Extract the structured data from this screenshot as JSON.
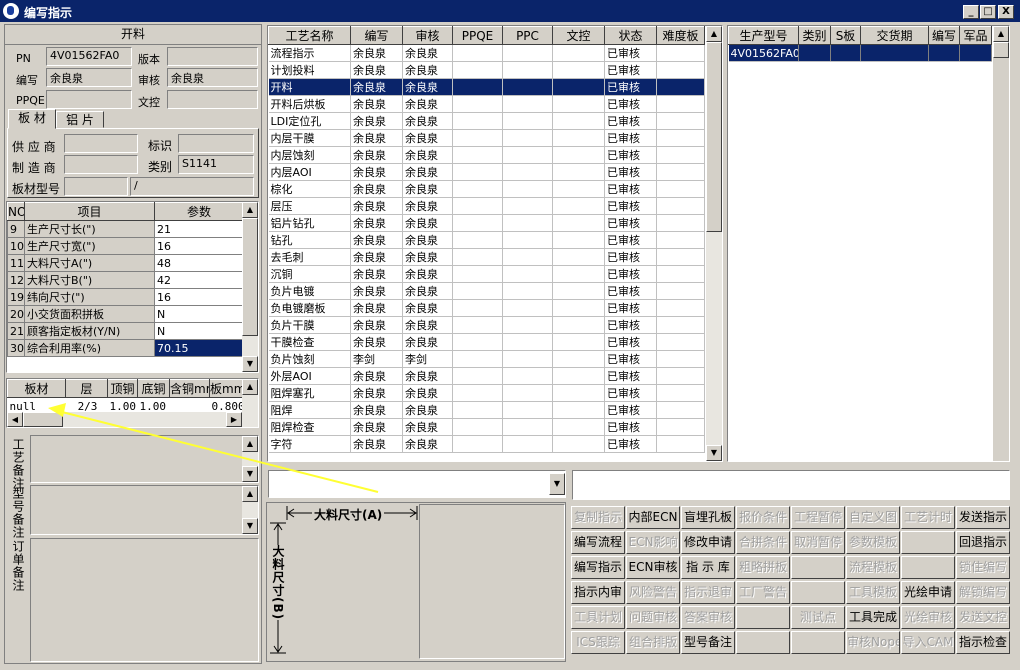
{
  "window": {
    "title": "编写指示",
    "minimize": "_",
    "maximize": "□",
    "close": "X"
  },
  "left": {
    "header": "开料",
    "fields": {
      "pn_label": "PN",
      "pn_value": "4V01562FA0",
      "version_label": "版本",
      "version_value": "",
      "author_label": "编写",
      "author_value": "余良泉",
      "review_label": "审核",
      "review_value": "余良泉",
      "ppqe_label": "PPQE",
      "ppqe_value": "",
      "doc_label": "文控",
      "doc_value": ""
    },
    "tabs": [
      "板 材",
      "铝 片"
    ],
    "material": {
      "supplier_label": "供 应 商",
      "supplier_value": "",
      "mark_label": "标识",
      "mark_value": "",
      "maker_label": "制 造 商",
      "maker_value": "",
      "category_label": "类别",
      "category_value": "S1141",
      "model_label": "板材型号",
      "model_value": "",
      "model_value2": "/"
    },
    "params": {
      "headers": [
        "NO",
        "项目",
        "参数"
      ],
      "rows": [
        [
          "9",
          "生产尺寸长(\")",
          "21"
        ],
        [
          "10",
          "生产尺寸宽(\")",
          "16"
        ],
        [
          "11",
          "大料尺寸A(\")",
          "48"
        ],
        [
          "12",
          "大料尺寸B(\")",
          "42"
        ],
        [
          "19",
          "纬向尺寸(\")",
          "16"
        ],
        [
          "20",
          "小交货面积拼板",
          "N"
        ],
        [
          "21",
          "顾客指定板材(Y/N)",
          "N"
        ],
        [
          "30",
          "综合利用率(%)",
          "70.15"
        ]
      ]
    },
    "board": {
      "headers": [
        "板材",
        "层",
        "顶铜",
        "底铜",
        "含铜mm",
        "板mm"
      ],
      "rows": [
        [
          "null",
          "2/3",
          "1.00",
          "1.00",
          "",
          "0.800"
        ]
      ]
    },
    "notes": {
      "process_label": "工艺备注",
      "type_label": "型号备注",
      "order_label": "订单备注"
    }
  },
  "process": {
    "headers": [
      "工艺名称",
      "编写",
      "审核",
      "PPQE",
      "PPC",
      "文控",
      "状态",
      "难度板"
    ],
    "selected_index": 2,
    "rows": [
      [
        "流程指示",
        "余良泉",
        "余良泉",
        "",
        "",
        "",
        "已审核",
        ""
      ],
      [
        "计划投料",
        "余良泉",
        "余良泉",
        "",
        "",
        "",
        "已审核",
        ""
      ],
      [
        "开料",
        "余良泉",
        "余良泉",
        "",
        "",
        "",
        "已审核",
        ""
      ],
      [
        "开料后烘板",
        "余良泉",
        "余良泉",
        "",
        "",
        "",
        "已审核",
        ""
      ],
      [
        "LDI定位孔",
        "余良泉",
        "余良泉",
        "",
        "",
        "",
        "已审核",
        ""
      ],
      [
        "内层干膜",
        "余良泉",
        "余良泉",
        "",
        "",
        "",
        "已审核",
        ""
      ],
      [
        "内层蚀刻",
        "余良泉",
        "余良泉",
        "",
        "",
        "",
        "已审核",
        ""
      ],
      [
        "内层AOI",
        "余良泉",
        "余良泉",
        "",
        "",
        "",
        "已审核",
        ""
      ],
      [
        "棕化",
        "余良泉",
        "余良泉",
        "",
        "",
        "",
        "已审核",
        ""
      ],
      [
        "层压",
        "余良泉",
        "余良泉",
        "",
        "",
        "",
        "已审核",
        ""
      ],
      [
        "铝片钻孔",
        "余良泉",
        "余良泉",
        "",
        "",
        "",
        "已审核",
        ""
      ],
      [
        "钻孔",
        "余良泉",
        "余良泉",
        "",
        "",
        "",
        "已审核",
        ""
      ],
      [
        "去毛刺",
        "余良泉",
        "余良泉",
        "",
        "",
        "",
        "已审核",
        ""
      ],
      [
        "沉铜",
        "余良泉",
        "余良泉",
        "",
        "",
        "",
        "已审核",
        ""
      ],
      [
        "负片电镀",
        "余良泉",
        "余良泉",
        "",
        "",
        "",
        "已审核",
        ""
      ],
      [
        "负电镀磨板",
        "余良泉",
        "余良泉",
        "",
        "",
        "",
        "已审核",
        ""
      ],
      [
        "负片干膜",
        "余良泉",
        "余良泉",
        "",
        "",
        "",
        "已审核",
        ""
      ],
      [
        "干膜检查",
        "余良泉",
        "余良泉",
        "",
        "",
        "",
        "已审核",
        ""
      ],
      [
        "负片蚀刻",
        "李剑",
        "李剑",
        "",
        "",
        "",
        "已审核",
        ""
      ],
      [
        "外层AOI",
        "余良泉",
        "余良泉",
        "",
        "",
        "",
        "已审核",
        ""
      ],
      [
        "阻焊塞孔",
        "余良泉",
        "余良泉",
        "",
        "",
        "",
        "已审核",
        ""
      ],
      [
        "阻焊",
        "余良泉",
        "余良泉",
        "",
        "",
        "",
        "已审核",
        ""
      ],
      [
        "阻焊检查",
        "余良泉",
        "余良泉",
        "",
        "",
        "",
        "已审核",
        ""
      ],
      [
        "字符",
        "余良泉",
        "余良泉",
        "",
        "",
        "",
        "已审核",
        ""
      ]
    ]
  },
  "production": {
    "headers": [
      "生产型号",
      "类别",
      "S板",
      "交货期",
      "编写",
      "军品"
    ],
    "rows": [
      [
        "4V01562FA0",
        "",
        "",
        "",
        "",
        ""
      ]
    ]
  },
  "diagram": {
    "a_label": "大料尺寸(A)",
    "b_label": "大料尺寸(B)"
  },
  "buttons": [
    [
      "复制指示",
      "内部ECN",
      "盲埋孔板",
      "报价条件",
      "工程暂停",
      "自定义图",
      "工艺计时",
      "发送指示"
    ],
    [
      "编写流程",
      "ECN影响",
      "修改申请",
      "合拼条件",
      "取消暂停",
      "参数模板",
      "",
      "回退指示"
    ],
    [
      "编写指示",
      "ECN审核",
      "指 示 库",
      "粗略拼板",
      "",
      "流程模板",
      "",
      "锁住编写"
    ],
    [
      "指示内审",
      "风险警告",
      "指示退审",
      "工厂警告",
      "",
      "工具模板",
      "光绘申请",
      "解锁编写"
    ],
    [
      "工具计划",
      "问题审核",
      "答案审核",
      "",
      "测试点",
      "工具完成",
      "光绘审核",
      "发送文控"
    ],
    [
      "ICS跟踪",
      "组合排版",
      "型号备注",
      "",
      "",
      "审核Nope",
      "导入CAM",
      "指示检查"
    ]
  ],
  "buttons_enabled": [
    [
      false,
      true,
      true,
      false,
      false,
      false,
      false,
      true
    ],
    [
      true,
      false,
      true,
      false,
      false,
      false,
      false,
      true
    ],
    [
      true,
      true,
      true,
      false,
      false,
      false,
      false,
      false
    ],
    [
      true,
      false,
      false,
      false,
      false,
      false,
      true,
      false
    ],
    [
      false,
      false,
      false,
      false,
      false,
      true,
      false,
      false
    ],
    [
      false,
      false,
      true,
      false,
      false,
      false,
      false,
      true
    ]
  ],
  "colors": {
    "titlebar": "#0a246a",
    "selection": "#0a246a",
    "face": "#d4d0c8",
    "arrow": "#ffff33"
  }
}
